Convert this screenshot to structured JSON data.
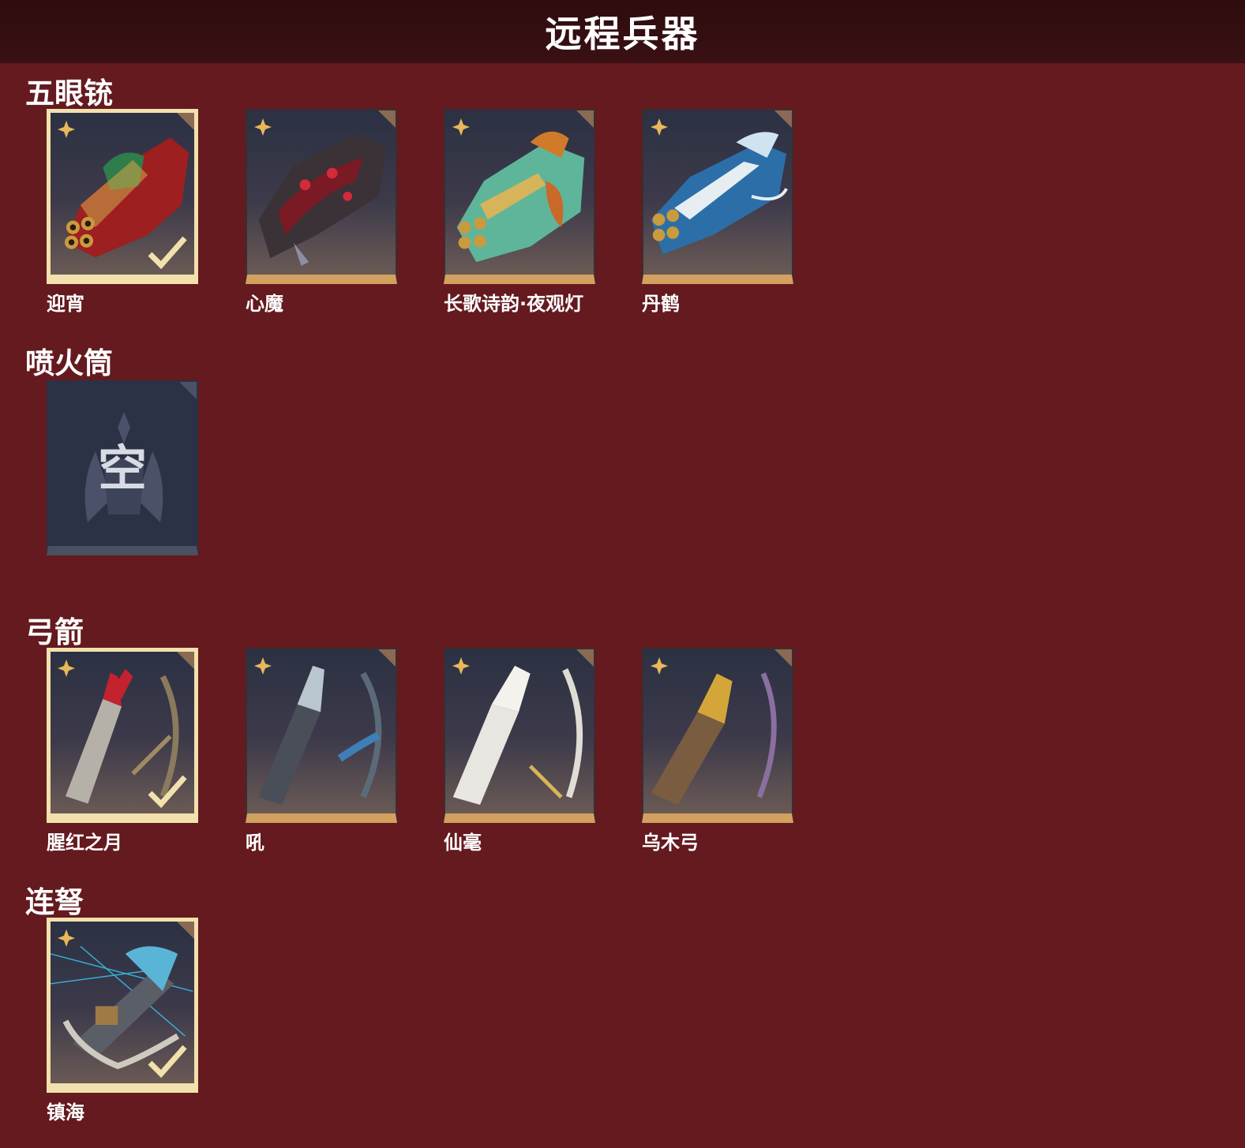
{
  "title": "远程兵器",
  "sections": [
    {
      "title": "五眼铳",
      "items": [
        {
          "name": "迎宵",
          "selected": true
        },
        {
          "name": "心魔",
          "selected": false
        },
        {
          "name": "长歌诗韵·夜观灯",
          "selected": false
        },
        {
          "name": "丹鹤",
          "selected": false
        }
      ]
    },
    {
      "title": "喷火筒",
      "items": [
        {
          "name": "",
          "empty_label": "空",
          "empty": true
        }
      ]
    },
    {
      "title": "弓箭",
      "items": [
        {
          "name": "腥红之月",
          "selected": true
        },
        {
          "name": "吼",
          "selected": false
        },
        {
          "name": "仙毫",
          "selected": false
        },
        {
          "name": "乌木弓",
          "selected": false
        }
      ]
    },
    {
      "title": "连弩",
      "items": [
        {
          "name": "镇海",
          "selected": true
        }
      ]
    }
  ],
  "colors": {
    "background": "#641a1f",
    "header": "#2e0c0e",
    "card_bar": "#d3a15f",
    "selected_border": "#f3e1ad",
    "rarity": "#e8b85a"
  },
  "icons": {
    "rarity": "four-petal-star-icon",
    "selected": "checkmark-icon",
    "corner": "corner-ribbon-icon"
  }
}
